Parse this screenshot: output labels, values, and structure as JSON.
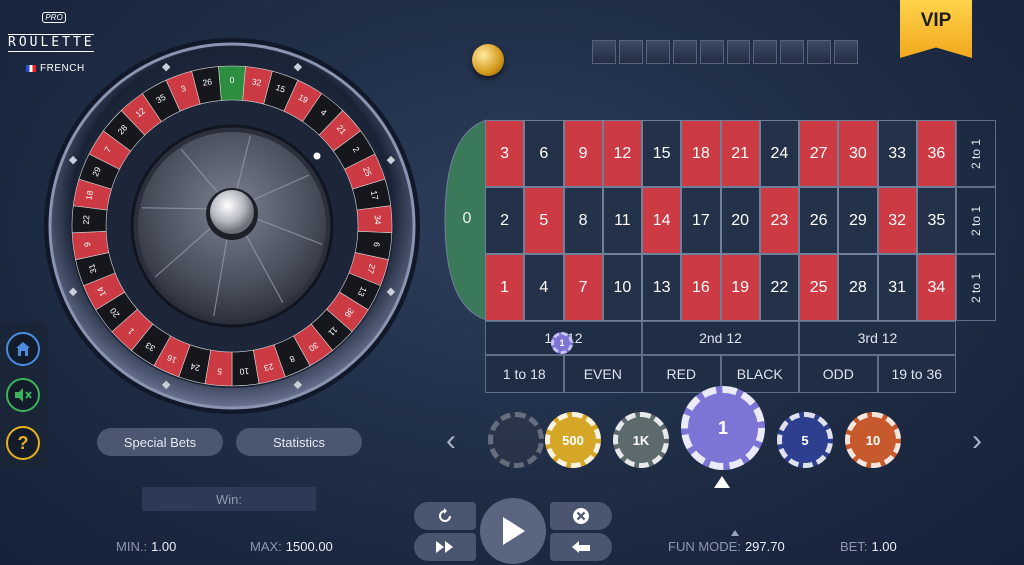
{
  "logo": {
    "badge": "PRO",
    "brand": "ROULETTE",
    "language": "FRENCH"
  },
  "vip_label": "VIP",
  "wheel": {
    "sequence": [
      "0",
      "32",
      "15",
      "19",
      "4",
      "21",
      "2",
      "25",
      "17",
      "34",
      "6",
      "27",
      "13",
      "36",
      "11",
      "30",
      "8",
      "23",
      "10",
      "5",
      "24",
      "16",
      "33",
      "1",
      "20",
      "14",
      "31",
      "9",
      "22",
      "18",
      "29",
      "7",
      "28",
      "12",
      "35",
      "3",
      "26"
    ],
    "reds": [
      "1",
      "3",
      "5",
      "7",
      "9",
      "12",
      "14",
      "16",
      "18",
      "19",
      "21",
      "23",
      "25",
      "27",
      "30",
      "32",
      "34",
      "36"
    ]
  },
  "side": {
    "home": "home-icon",
    "sound": "mute-icon",
    "help": "?"
  },
  "buttons": {
    "special_bets": "Special Bets",
    "statistics": "Statistics"
  },
  "win": {
    "label": "Win:"
  },
  "limits": {
    "min_label": "MIN.:",
    "min_value": "1.00",
    "max_label": "MAX:",
    "max_value": "1500.00"
  },
  "footer": {
    "mode_label": "FUN MODE:",
    "mode_value": "297.70",
    "bet_label": "BET:",
    "bet_value": "1.00"
  },
  "table": {
    "zero": "0",
    "rows": [
      [
        "3",
        "6",
        "9",
        "12",
        "15",
        "18",
        "21",
        "24",
        "27",
        "30",
        "33",
        "36"
      ],
      [
        "2",
        "5",
        "8",
        "11",
        "14",
        "17",
        "20",
        "23",
        "26",
        "29",
        "32",
        "35"
      ],
      [
        "1",
        "4",
        "7",
        "10",
        "13",
        "16",
        "19",
        "22",
        "25",
        "28",
        "31",
        "34"
      ]
    ],
    "columns": [
      "2 to 1",
      "2 to 1",
      "2 to 1"
    ],
    "dozens": [
      "1st 12",
      "2nd 12",
      "3rd 12"
    ],
    "even_money": [
      "1 to 18",
      "EVEN",
      "RED",
      "BLACK",
      "ODD",
      "19 to 36"
    ],
    "placed_chip": "1"
  },
  "chips": [
    {
      "label": "",
      "color": "#3a3f4c"
    },
    {
      "label": "500",
      "color": "#d6a626"
    },
    {
      "label": "1K",
      "color": "#5c6a6e"
    },
    {
      "label": "1",
      "color": "#7c75d6",
      "selected": true
    },
    {
      "label": "5",
      "color": "#2d3f8e"
    },
    {
      "label": "10",
      "color": "#c65a2c"
    }
  ],
  "colors": {
    "red": "#cc3a44",
    "black": "#233249",
    "green": "#2c8f3f",
    "felt": "#3a7a5a"
  }
}
